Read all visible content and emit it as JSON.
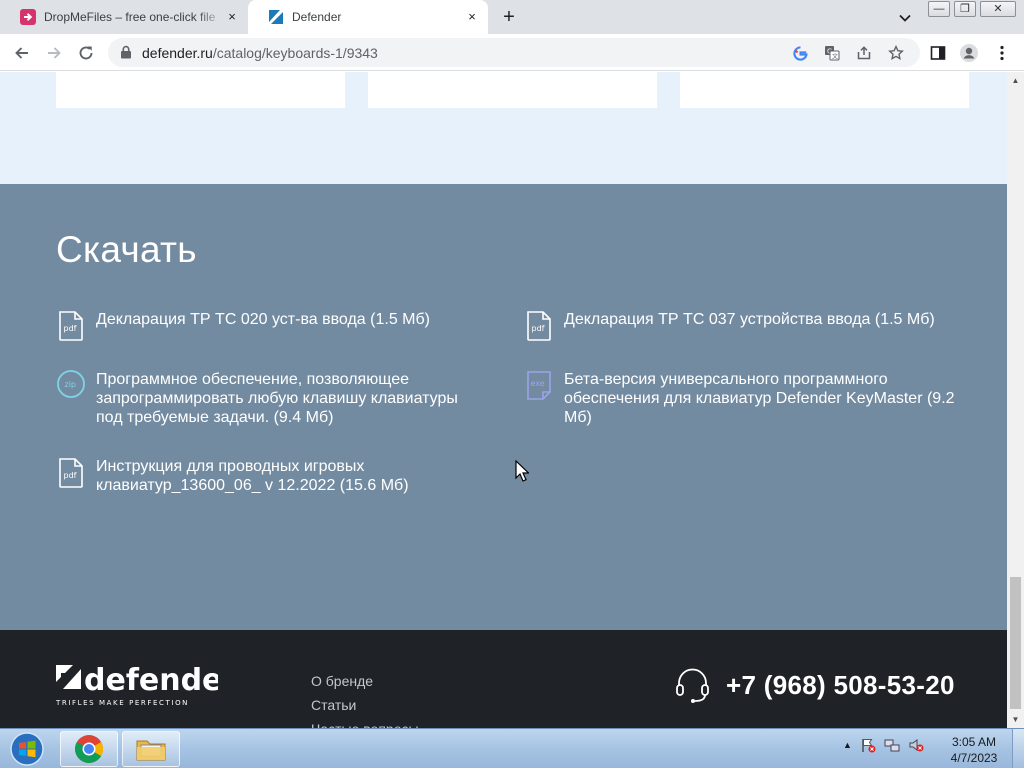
{
  "browser": {
    "tabs": [
      {
        "title": "DropMeFiles – free one-click file",
        "close": "×",
        "active": false
      },
      {
        "title": "Defender",
        "close": "×",
        "active": true
      }
    ],
    "new_tab": "+",
    "window_controls": {
      "minimize": "—",
      "maximize": "❐",
      "close": "✕"
    },
    "url_host": "defender.ru",
    "url_path": "/catalog/keyboards-1/9343",
    "toolbar_icons": [
      "back-arrow-icon",
      "forward-arrow-icon",
      "reload-icon",
      "lock-icon",
      "google-icon",
      "translate-icon",
      "share-icon",
      "star-icon",
      "sidebar-icon",
      "profile-icon",
      "menu-kebab-icon"
    ]
  },
  "page": {
    "download": {
      "heading": "Скачать",
      "items": [
        {
          "type": "pdf",
          "text": "Декларация ТР ТС 020 уст-ва ввода (1.5 Мб)"
        },
        {
          "type": "pdf",
          "text": "Декларация ТР ТС 037 устройства ввода (1.5 Мб)"
        },
        {
          "type": "zip",
          "text": "Программное обеспечение, позволяющее запрограммировать любую клавишу клавиатуры под требуемые задачи. (9.4 Мб)"
        },
        {
          "type": "exe",
          "text": "Бета-версия универсального программного обеспечения для клавиатур Defender KeyMaster (9.2 Мб)"
        },
        {
          "type": "pdf",
          "text": "Инструкция для проводных игровых клавиатур_13600_06_ v 12.2022 (15.6 Мб)"
        }
      ]
    },
    "footer": {
      "logo_text": "defender",
      "logo_tagline": "TRIFLES MAKE PERFECTION",
      "nav": [
        "О бренде",
        "Статьи",
        "Частые вопросы"
      ],
      "phone": "+7 (968) 508-53-20"
    }
  },
  "taskbar": {
    "clock_time": "3:05 AM",
    "clock_date": "4/7/2023",
    "tray_arrow": "▲"
  },
  "colors": {
    "download_bg": "#738ba1",
    "footer_bg": "#1f2226",
    "page_bg": "#e6f1fb",
    "pdf_icon": "#ffffff",
    "zip_icon": "#7fd3e8",
    "exe_icon": "#9aa4e8"
  }
}
